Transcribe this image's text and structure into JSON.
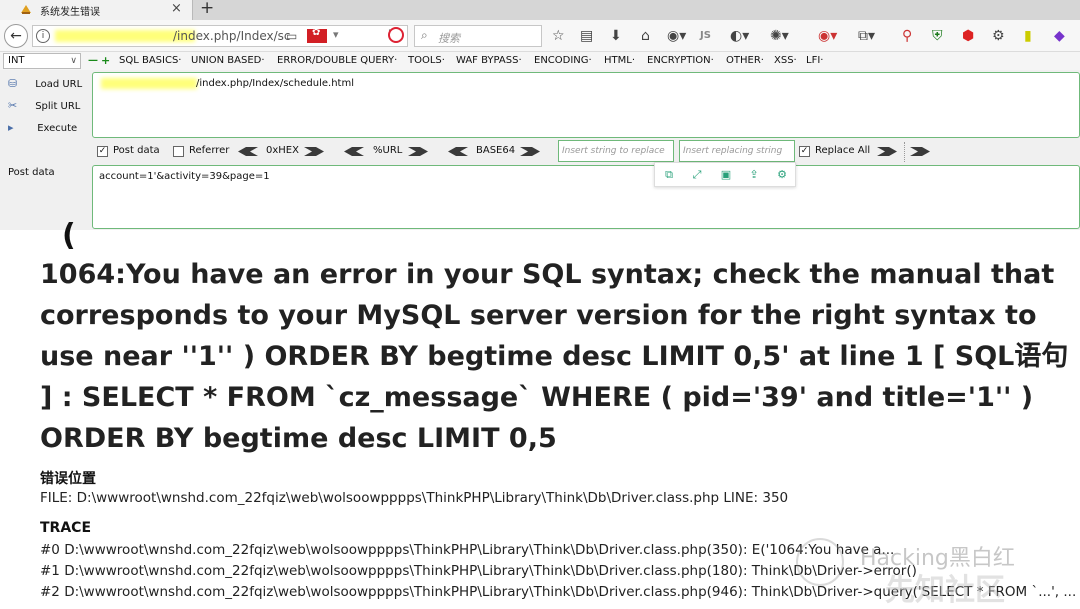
{
  "browser": {
    "tab_title": "系统发生错误",
    "tab_close": "×",
    "new_tab": "+",
    "url_partial": "/index.php/Index/sc",
    "search_placeholder": "搜索",
    "toolbar_js_label": "JS"
  },
  "hackbar": {
    "select_value": "INT",
    "minus": "—",
    "plus": "+",
    "menu": [
      "SQL BASICS·",
      "UNION BASED·",
      "ERROR/DOUBLE QUERY·",
      "TOOLS·",
      "WAF BYPASS·",
      "ENCODING·",
      "HTML·",
      "ENCRYPTION·",
      "OTHER·",
      "XSS·",
      "LFI·"
    ],
    "load_url": "Load URL",
    "split_url": "Split URL",
    "execute": "Execute",
    "url_value": "/index.php/Index/schedule.html",
    "post_data_checkbox": "Post data",
    "referrer_checkbox": "Referrer",
    "hex_label": "0xHEX",
    "url_enc_label": "%URL",
    "base64_label": "BASE64",
    "replace_placeholder": "Insert string to replace",
    "replacing_placeholder": "Insert replacing string",
    "replace_all": "Replace All",
    "post_label": "Post data",
    "post_value": "account=1'&activity=39&page=1"
  },
  "page": {
    "fragment": "(",
    "error_message": "1064:You have an error in your SQL syntax; check the manual that corresponds to your MySQL server version for the right syntax to use near ''1'' ) ORDER BY begtime desc LIMIT 0,5' at line 1 [ SQL语句 ] : SELECT * FROM `cz_message` WHERE ( pid='39' and title='1'' ) ORDER BY begtime desc LIMIT 0,5",
    "error_location_heading": "错误位置",
    "file_line": "FILE: D:\\wwwroot\\wnshd.com_22fqiz\\web\\wolsoowpppps\\ThinkPHP\\Library\\Think\\Db\\Driver.class.php      LINE: 350",
    "trace_heading": "TRACE",
    "trace": [
      "#0 D:\\wwwroot\\wnshd.com_22fqiz\\web\\wolsoowpppps\\ThinkPHP\\Library\\Think\\Db\\Driver.class.php(350): E('1064:You have a...",
      "#1 D:\\wwwroot\\wnshd.com_22fqiz\\web\\wolsoowpppps\\ThinkPHP\\Library\\Think\\Db\\Driver.class.php(180): Think\\Db\\Driver->error()",
      "#2 D:\\wwwroot\\wnshd.com_22fqiz\\web\\wolsoowpppps\\ThinkPHP\\Library\\Think\\Db\\Driver.class.php(946): Think\\Db\\Driver->query('SELECT * FROM `...', ..."
    ]
  },
  "watermark": {
    "text1": "Hacking黑白红",
    "text2": "先知社区"
  }
}
